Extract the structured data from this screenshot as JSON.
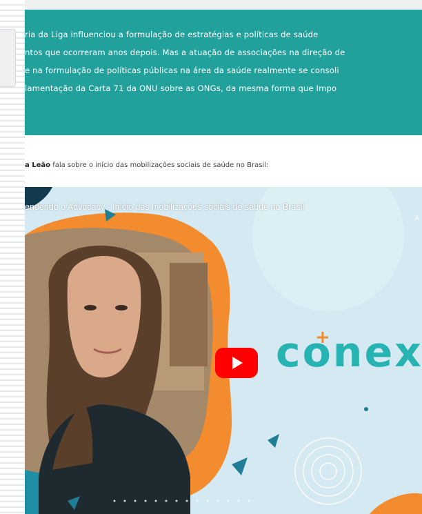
{
  "banner": {
    "lines": [
      "ria da Liga influenciou a formulação de estratégias e políticas de saúde",
      "ntos que ocorreram anos depois. Mas a atuação de associações na direção de",
      "e na formulação de políticas públicas na área da saúde realmente se consoli",
      "lamentação da Carta 71 da ONU sobre as ONGs, da mesma forma que Impo"
    ],
    "color": "#22a09b"
  },
  "caption": {
    "name": "a Leão",
    "text": " fala sobre o início das mobilizações sociais de saúde no Brasil:"
  },
  "video": {
    "title": "endendo o Advocacy - Início das mobilizações sociais de saúde no Brasil",
    "more_label": "A",
    "play_icon": "youtube-play-icon",
    "logo_text": "conex",
    "logo_colors": {
      "text": "#26b3b2",
      "plus": "#f28c2e"
    },
    "accent_orange": "#f28c2e",
    "accent_teal": "#1f7d96"
  }
}
